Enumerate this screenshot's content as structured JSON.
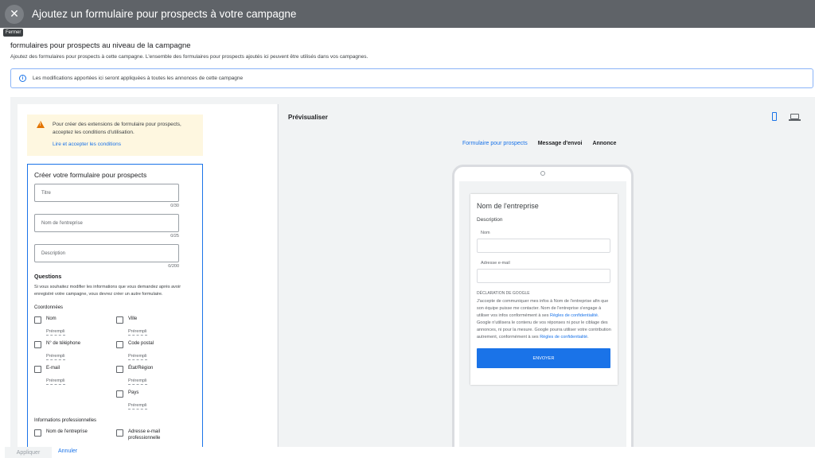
{
  "header": {
    "title": "Ajoutez un formulaire pour prospects à votre campagne",
    "close_tooltip": "Fermer"
  },
  "intro": {
    "title": "formulaires pour prospects au niveau de la campagne",
    "description": "Ajoutez des formulaires pour prospects à cette campagne. L'ensemble des formulaires pour prospects ajoutés ici peuvent être utilisés dans vos campagnes.",
    "banner": "Les modifications apportées ici seront appliquées à toutes les annonces de cette campagne"
  },
  "warning": {
    "text": "Pour créer des extensions de formulaire pour prospects, acceptez les conditions d'utilisation.",
    "link": "Lire et accepter les conditions"
  },
  "form": {
    "title": "Créer votre formulaire pour prospects",
    "fields": [
      {
        "placeholder": "Titre",
        "counter": "0/30"
      },
      {
        "placeholder": "Nom de l'entreprise",
        "counter": "0/25"
      },
      {
        "placeholder": "Description",
        "counter": "0/200"
      }
    ],
    "questions_title": "Questions",
    "questions_desc": "Si vous souhaitez modifier les informations que vous demandez après avoir enregistré votre campagne, vous devrez créer un autre formulaire.",
    "contact_title": "Coordonnées",
    "contact_items": [
      {
        "label": "Nom",
        "sub": "Prérempli"
      },
      {
        "label": "Ville",
        "sub": "Prérempli"
      },
      {
        "label": "N° de téléphone",
        "sub": "Prérempli"
      },
      {
        "label": "Code postal",
        "sub": "Prérempli"
      },
      {
        "label": "E-mail",
        "sub": "Prérempli"
      },
      {
        "label": "État/Région",
        "sub": "Prérempli"
      },
      {
        "label": "",
        "sub": ""
      },
      {
        "label": "Pays",
        "sub": "Prérempli"
      }
    ],
    "pro_title": "Informations professionnelles",
    "pro_items": [
      {
        "label": "Nom de l'entreprise"
      },
      {
        "label": "Adresse e-mail professionnelle"
      }
    ]
  },
  "preview": {
    "title": "Prévisualiser",
    "tabs": [
      "Formulaire pour prospects",
      "Message d'envoi",
      "Annonce"
    ],
    "company": "Nom de l'entreprise",
    "description": "Description",
    "name_label": "Nom",
    "email_label": "Adresse e-mail",
    "decl_title": "DÉCLARATION DE GOOGLE",
    "decl_part1": "J'accepte de communiquer mes infos à Nom de l'entreprise afin que son équipe puisse me contacter. Nom de l'entreprise s'engage à utiliser vos infos conformément à ses",
    "decl_link1": "Règles de confidentialité",
    "decl_part2": ". Google n'utilisera le contenu de vos réponses ni pour le ciblage des annonces, ni pour la mesure. Google pourra utiliser votre contribution autrement, conformément à ses",
    "decl_link2": "Règles de confidentialité",
    "decl_part3": ".",
    "submit": "ENVOYER"
  },
  "footer": {
    "apply": "Appliquer",
    "cancel": "Annuler"
  }
}
